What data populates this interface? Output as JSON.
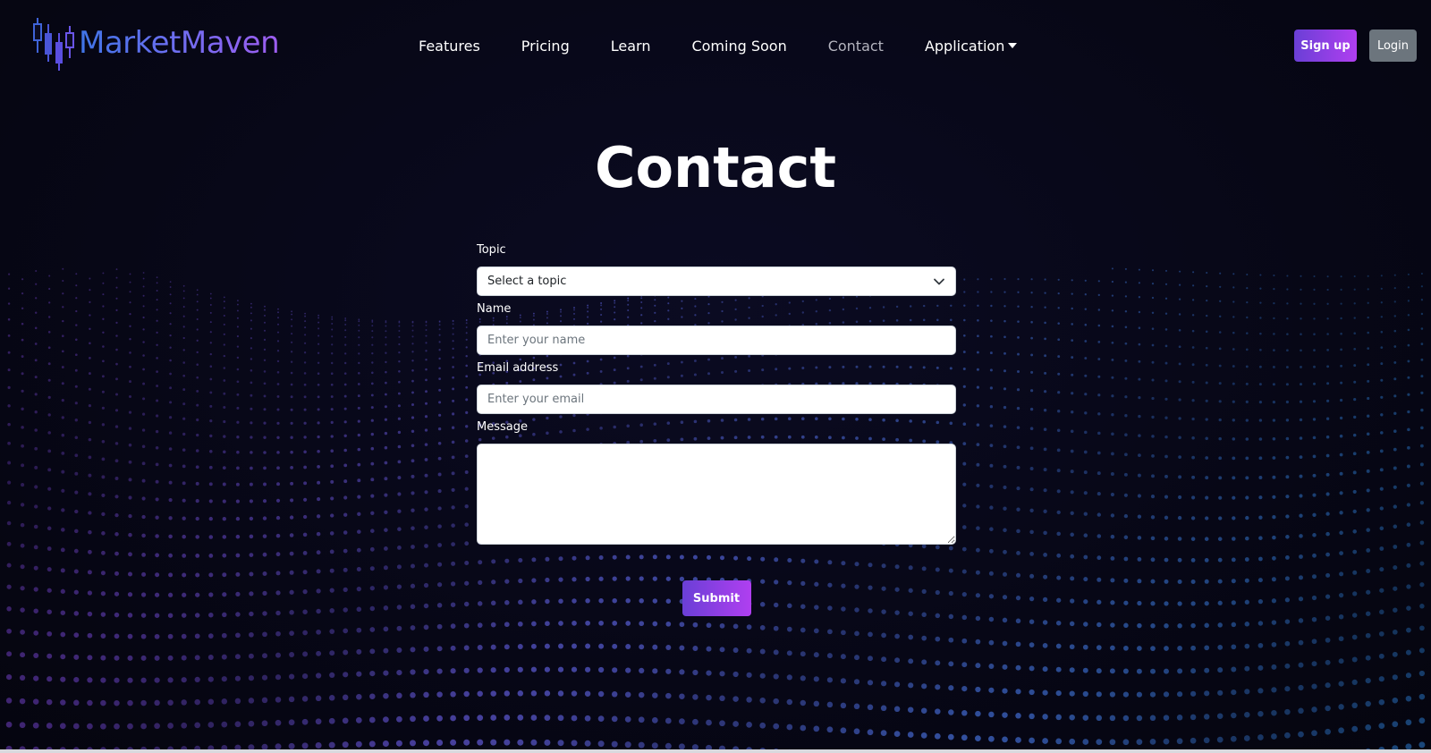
{
  "brand": {
    "name": "MarketMaven",
    "logo_icon": "candlestick-chart-icon"
  },
  "nav": {
    "items": [
      {
        "label": "Features"
      },
      {
        "label": "Pricing"
      },
      {
        "label": "Learn"
      },
      {
        "label": "Coming Soon"
      },
      {
        "label": "Contact",
        "active": true
      },
      {
        "label": "Application",
        "dropdown": true
      }
    ]
  },
  "auth": {
    "signup_label": "Sign up",
    "login_label": "Login"
  },
  "page": {
    "title": "Contact"
  },
  "form": {
    "topic_label": "Topic",
    "topic_value": "Select a topic",
    "name_label": "Name",
    "name_placeholder": "Enter your name",
    "email_label": "Email address",
    "email_placeholder": "Enter your email",
    "message_label": "Message",
    "message_value": "",
    "submit_label": "Submit"
  },
  "colors": {
    "background": "#070716",
    "accent_gradient_start": "#6a3fd6",
    "accent_gradient_end": "#b03ff0",
    "login_button": "#6c757d",
    "active_nav": "#b4b4bf"
  }
}
